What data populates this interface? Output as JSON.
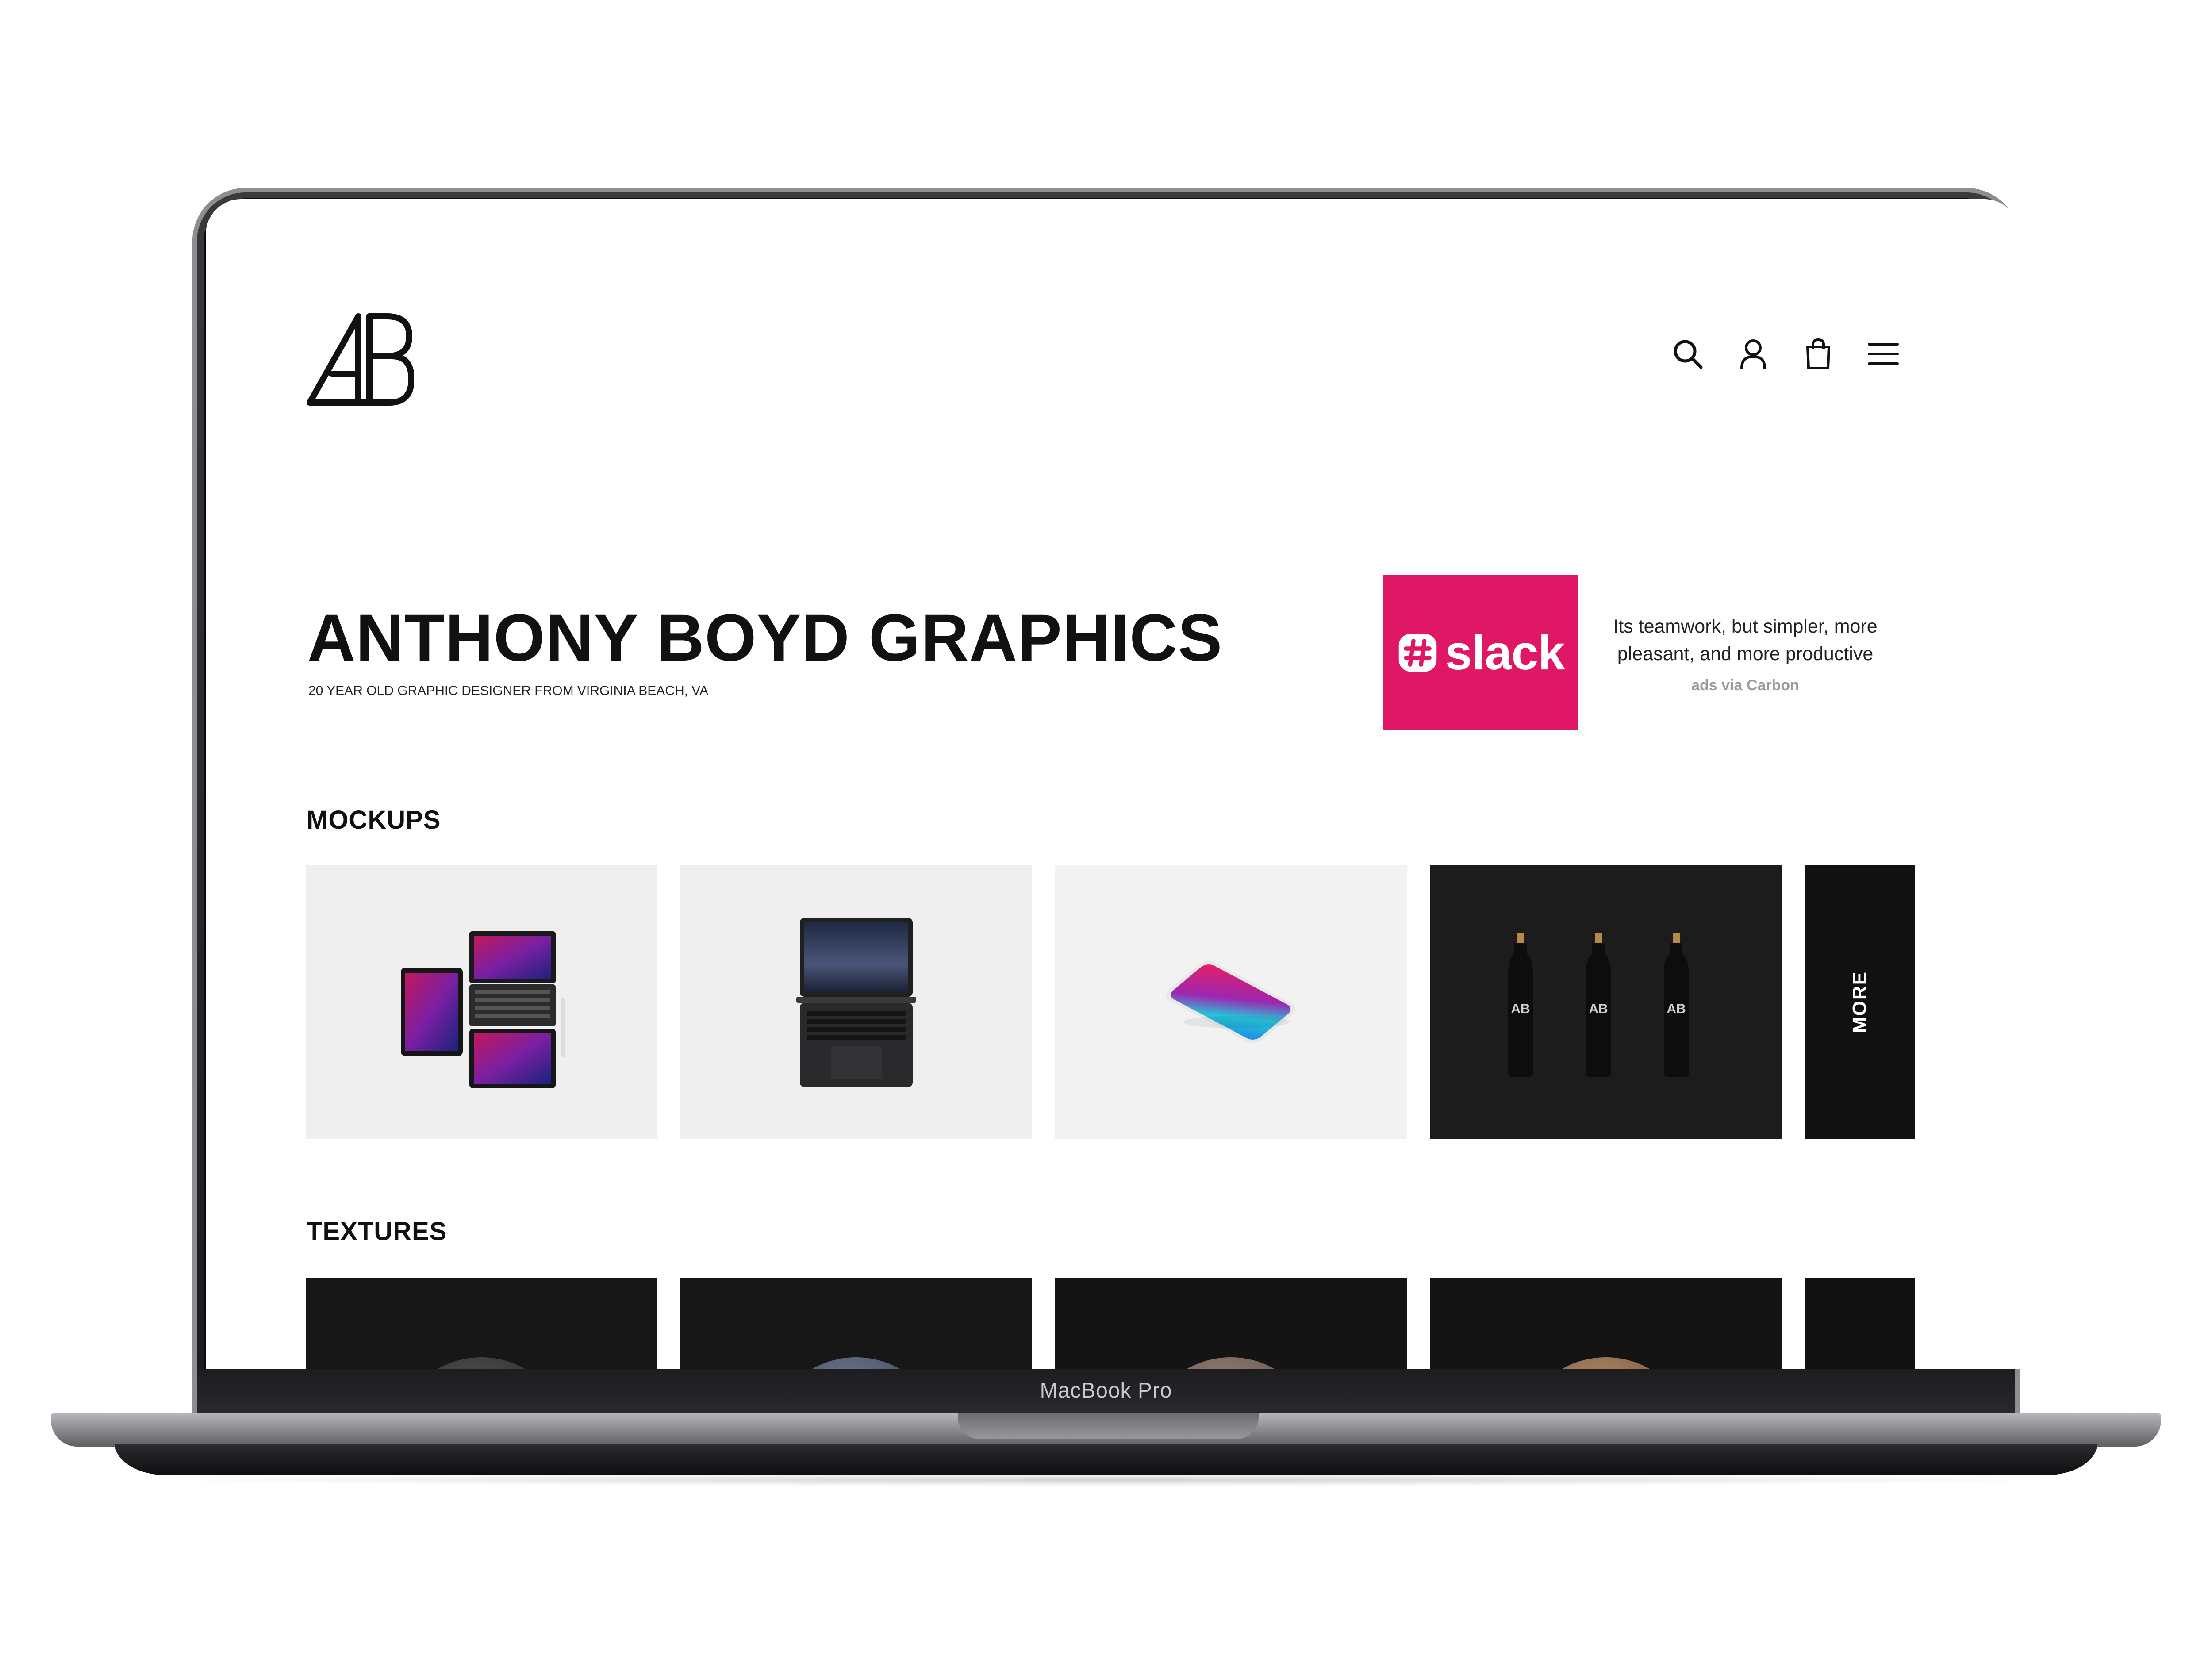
{
  "device": {
    "label": "MacBook Pro"
  },
  "site": {
    "logo_text": "AB",
    "nav": {
      "icons": [
        "search-icon",
        "user-icon",
        "shopping-bag-icon",
        "menu-icon"
      ]
    },
    "hero": {
      "title": "ANTHONY BOYD GRAPHICS",
      "subtitle": "20 YEAR OLD GRAPHIC DESIGNER FROM VIRGINIA BEACH, VA"
    },
    "ad": {
      "brand": "slack",
      "copy": "Its teamwork, but simpler, more pleasant, and more productive",
      "via": "ads via Carbon",
      "brand_color": "#e01765"
    },
    "sections": [
      {
        "heading": "MOCKUPS",
        "cards": [
          "ipad-devices-mockup",
          "macbook-top-view-mockup",
          "iphone-isometric-mockup",
          "black-bottles-mockup"
        ],
        "more_label": "MORE"
      },
      {
        "heading": "TEXTURES",
        "cards": [
          "dark-fabric-sphere",
          "blue-fabric-sphere",
          "wood-sphere",
          "light-wood-sphere"
        ]
      }
    ],
    "bottle_logo": "AB"
  }
}
